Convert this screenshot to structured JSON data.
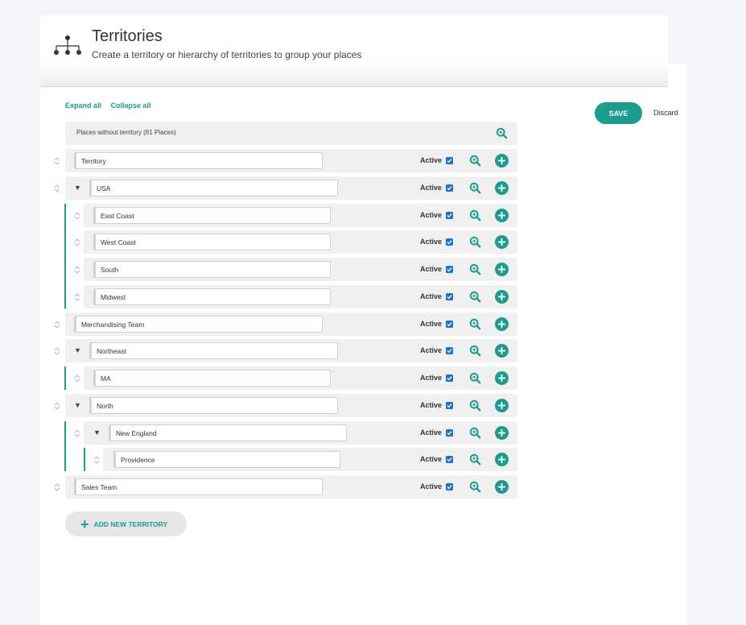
{
  "header": {
    "title": "Territories",
    "subtitle": "Create a territory or hierarchy of territories to group your places"
  },
  "toolbar": {
    "expand_all": "Expand all",
    "collapse_all": "Collapse all",
    "save": "SAVE",
    "discard": "Discard"
  },
  "unassigned": {
    "label": "Places without territory (81 Places)"
  },
  "active_label": "Active",
  "add_new_label": "ADD NEW TERRITORY",
  "colors": {
    "accent": "#1a9c8f",
    "checkbox": "#1e72d0"
  },
  "territories": [
    {
      "name": "Territory",
      "depth": 0,
      "expandable": false,
      "active": true
    },
    {
      "name": "USA",
      "depth": 0,
      "expandable": true,
      "active": true
    },
    {
      "name": "East Coast",
      "depth": 1,
      "expandable": false,
      "active": true
    },
    {
      "name": "West Coast",
      "depth": 1,
      "expandable": false,
      "active": true
    },
    {
      "name": "South",
      "depth": 1,
      "expandable": false,
      "active": true
    },
    {
      "name": "Midwest",
      "depth": 1,
      "expandable": false,
      "active": true
    },
    {
      "name": "Merchandising Team",
      "depth": 0,
      "expandable": false,
      "active": true
    },
    {
      "name": "Northeast",
      "depth": 0,
      "expandable": true,
      "active": true
    },
    {
      "name": "MA",
      "depth": 1,
      "expandable": false,
      "active": true
    },
    {
      "name": "North",
      "depth": 0,
      "expandable": true,
      "active": true
    },
    {
      "name": "New England",
      "depth": 1,
      "expandable": true,
      "active": true
    },
    {
      "name": "Providence",
      "depth": 2,
      "expandable": false,
      "active": true
    },
    {
      "name": "Sales Team",
      "depth": 0,
      "expandable": false,
      "active": true
    }
  ]
}
